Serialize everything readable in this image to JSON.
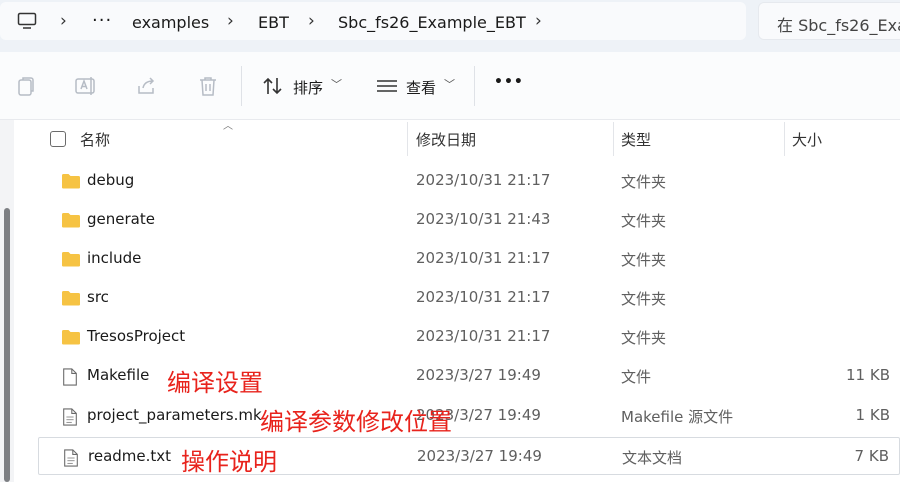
{
  "breadcrumbs": [
    "examples",
    "EBT",
    "Sbc_fs26_Example_EBT"
  ],
  "search": {
    "placeholder": "在 Sbc_fs26_Exa"
  },
  "toolbar": {
    "sort_label": "排序",
    "view_label": "查看",
    "more_label": "•••"
  },
  "columns": {
    "name": "名称",
    "date": "修改日期",
    "type": "类型",
    "size": "大小"
  },
  "rows": [
    {
      "name": "debug",
      "date": "2023/10/31 21:17",
      "type": "文件夹",
      "size": "",
      "icon": "folder-icon",
      "annotation": ""
    },
    {
      "name": "generate",
      "date": "2023/10/31 21:43",
      "type": "文件夹",
      "size": "",
      "icon": "folder-icon",
      "annotation": ""
    },
    {
      "name": "include",
      "date": "2023/10/31 21:17",
      "type": "文件夹",
      "size": "",
      "icon": "folder-icon",
      "annotation": ""
    },
    {
      "name": "src",
      "date": "2023/10/31 21:17",
      "type": "文件夹",
      "size": "",
      "icon": "folder-icon",
      "annotation": ""
    },
    {
      "name": "TresosProject",
      "date": "2023/10/31 21:17",
      "type": "文件夹",
      "size": "",
      "icon": "folder-icon",
      "annotation": ""
    },
    {
      "name": "Makefile",
      "date": "2023/3/27 19:49",
      "type": "文件",
      "size": "11 KB",
      "icon": "file-icon",
      "annotation": "编译设置"
    },
    {
      "name": "project_parameters.mk",
      "date": "2023/3/27 19:49",
      "type": "Makefile 源文件",
      "size": "1 KB",
      "icon": "text-file-icon",
      "annotation": "编译参数修改位置"
    },
    {
      "name": "readme.txt",
      "date": "2023/3/27 19:49",
      "type": "文本文档",
      "size": "7 KB",
      "icon": "text-file-icon",
      "annotation": "操作说明"
    }
  ],
  "colors": {
    "folder": "#f6c343",
    "annotation": "#e8231c",
    "toolbar_bg": "#fbfcfd",
    "address_bg": "#eef2f7"
  }
}
